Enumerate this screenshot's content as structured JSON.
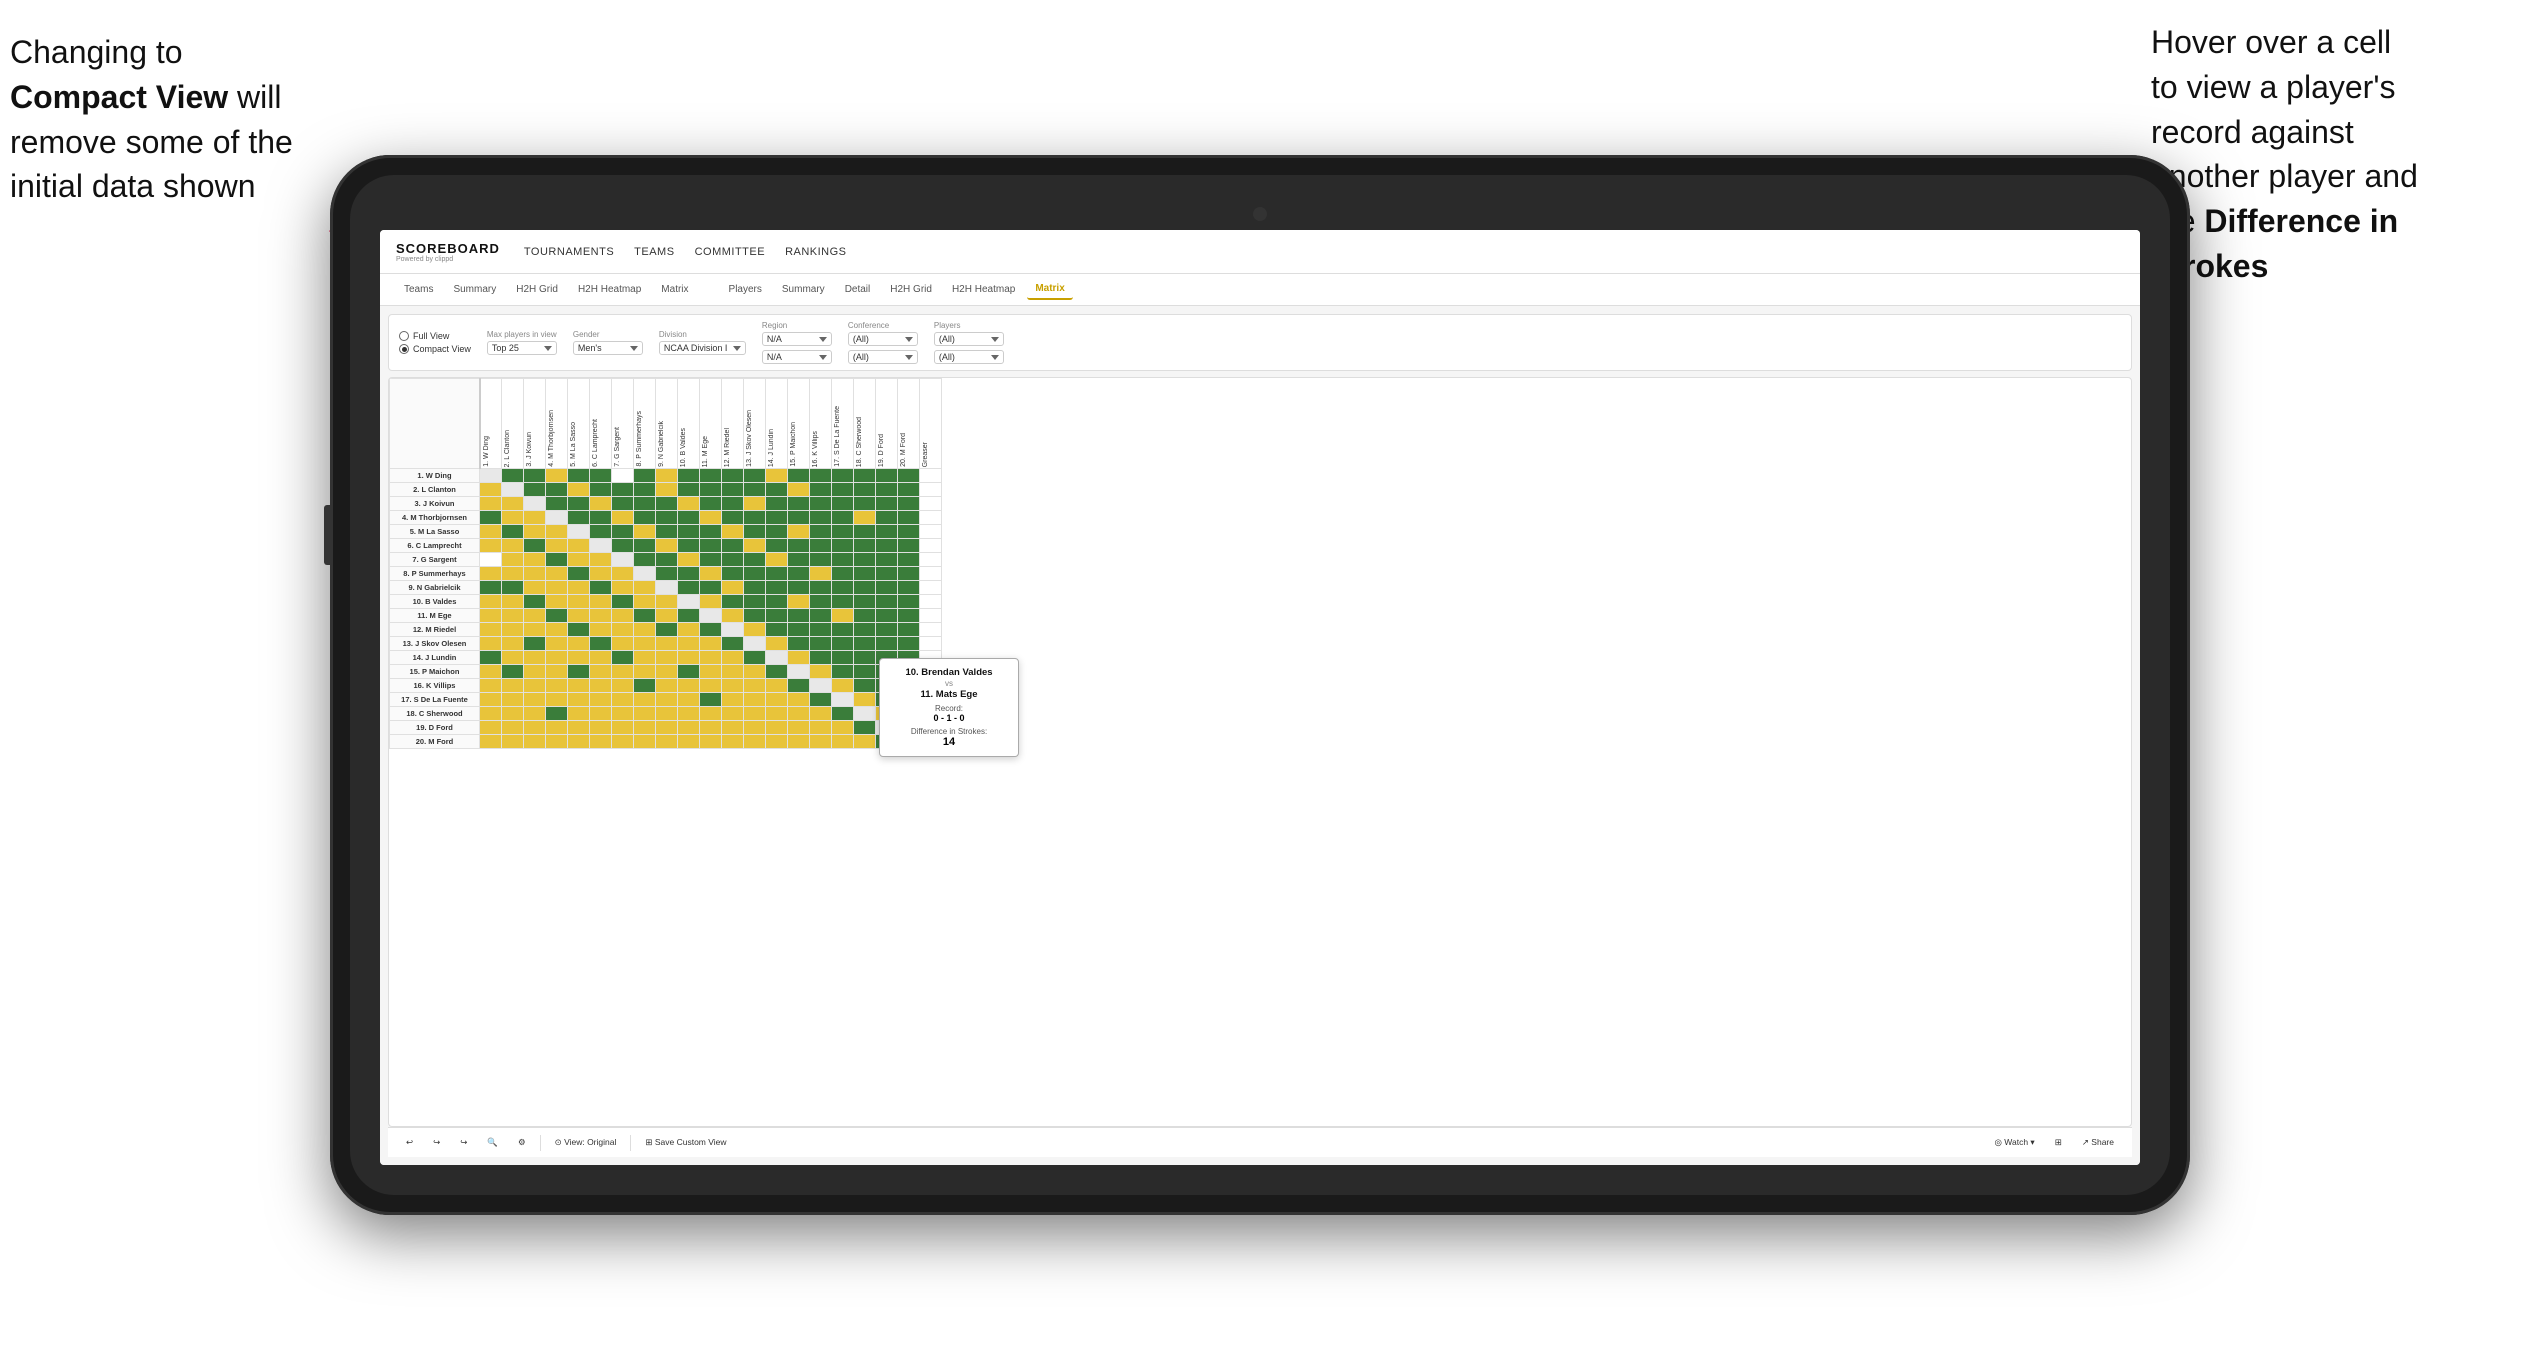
{
  "annotations": {
    "left_text_line1": "Changing to",
    "left_text_bold": "Compact View",
    "left_text_line3": " will",
    "left_text_line2": "remove some of the",
    "left_text_line4": "initial data shown",
    "right_text_line1": "Hover over a cell",
    "right_text_line2": "to view a player's",
    "right_text_line3": "record against",
    "right_text_line4": "another player and",
    "right_text_line5": "the ",
    "right_text_bold": "Difference in",
    "right_text_line6": "Strokes"
  },
  "app": {
    "logo_title": "SCOREBOARD",
    "logo_sub": "Powered by clippd",
    "nav_items": [
      "TOURNAMENTS",
      "TEAMS",
      "COMMITTEE",
      "RANKINGS"
    ]
  },
  "sub_tabs": {
    "group1": [
      "Teams",
      "Summary",
      "H2H Grid",
      "H2H Heatmap",
      "Matrix"
    ],
    "group2": [
      "Players",
      "Summary",
      "Detail",
      "H2H Grid",
      "H2H Heatmap",
      "Matrix"
    ],
    "active": "Matrix"
  },
  "filters": {
    "view_options": [
      "Full View",
      "Compact View"
    ],
    "selected_view": "Compact View",
    "max_players_label": "Max players in view",
    "max_players_value": "Top 25",
    "gender_label": "Gender",
    "gender_value": "Men's",
    "division_label": "Division",
    "division_value": "NCAA Division I",
    "region_label": "Region",
    "region_values": [
      "N/A",
      "N/A"
    ],
    "conference_label": "Conference",
    "conference_values": [
      "(All)",
      "(All)"
    ],
    "players_label": "Players",
    "players_values": [
      "(All)",
      "(All)"
    ]
  },
  "matrix": {
    "col_headers": [
      "1. W Ding",
      "2. L Clanton",
      "3. J Koivun",
      "4. M Thorbjornsen",
      "5. M La Sasso",
      "6. C Lamprecht",
      "7. G Sargent",
      "8. P Summerhays",
      "9. N Gabrielcik",
      "10. B Valdes",
      "11. M Ege",
      "12. M Riedel",
      "13. J Skov Olesen",
      "14. J Lundin",
      "15. P Maichon",
      "16. K Villips",
      "17. S De La Fuente",
      "18. C Sherwood",
      "19. D Ford",
      "20. M Ford",
      "Greaser"
    ],
    "row_labels": [
      "1. W Ding",
      "2. L Clanton",
      "3. J Koivun",
      "4. M Thorbjornsen",
      "5. M La Sasso",
      "6. C Lamprecht",
      "7. G Sargent",
      "8. P Summerhays",
      "9. N Gabrielcik",
      "10. B Valdes",
      "11. M Ege",
      "12. M Riedel",
      "13. J Skov Olesen",
      "14. J Lundin",
      "15. P Maichon",
      "16. K Villips",
      "17. S De La Fuente",
      "18. C Sherwood",
      "19. D Ford",
      "20. M Ford"
    ]
  },
  "tooltip": {
    "player1": "10. Brendan Valdes",
    "vs": "vs",
    "player2": "11. Mats Ege",
    "record_label": "Record:",
    "record_value": "0 - 1 - 0",
    "diff_label": "Difference in Strokes:",
    "diff_value": "14"
  },
  "toolbar": {
    "undo_label": "↩",
    "redo_label": "↪",
    "view_original": "⊙ View: Original",
    "save_custom": "⊞ Save Custom View",
    "watch": "◎ Watch ▾",
    "share": "↗ Share"
  }
}
